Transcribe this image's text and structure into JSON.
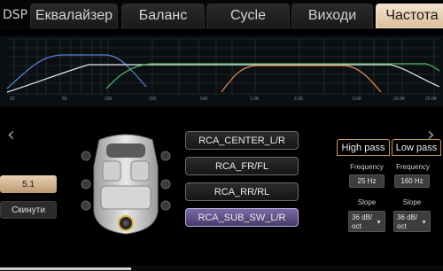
{
  "tabs": {
    "logo": "DSP",
    "items": [
      {
        "label": "Еквалайзер"
      },
      {
        "label": "Баланс"
      },
      {
        "label": "Cycle"
      },
      {
        "label": "Виходи"
      },
      {
        "label": "Частота"
      }
    ],
    "active_index": 4
  },
  "graph": {
    "freq_ticks": [
      "20",
      "50",
      "100",
      "200",
      "500",
      "1.0K",
      "2.0K",
      "5.0K",
      "10.0K",
      "20.0K"
    ],
    "curves": [
      {
        "name": "blue",
        "color": "#5b86d6"
      },
      {
        "name": "white",
        "color": "#e6e6e6"
      },
      {
        "name": "green",
        "color": "#4fbf6a"
      },
      {
        "name": "orange",
        "color": "#e08b5a"
      }
    ]
  },
  "controls": {
    "preset_label": "5.1",
    "reset_label": "Скинути",
    "prev_icon": "chevron-left",
    "next_icon": "chevron-right",
    "channels": [
      {
        "label": "RCA_CENTER_L/R",
        "selected": false
      },
      {
        "label": "RCA_FR/FL",
        "selected": false
      },
      {
        "label": "RCA_RR/RL",
        "selected": false
      },
      {
        "label": "RCA_SUB_SW_L/R",
        "selected": true
      }
    ]
  },
  "filters": {
    "high_pass": {
      "title": "High pass",
      "frequency_label": "Frequency",
      "frequency": "25 Hz",
      "slope_label": "Slope",
      "slope": "36 dB/\noct"
    },
    "low_pass": {
      "title": "Low pass",
      "frequency_label": "Frequency",
      "frequency": "160 Hz",
      "slope_label": "Slope",
      "slope": "36 dB/\noct"
    }
  }
}
